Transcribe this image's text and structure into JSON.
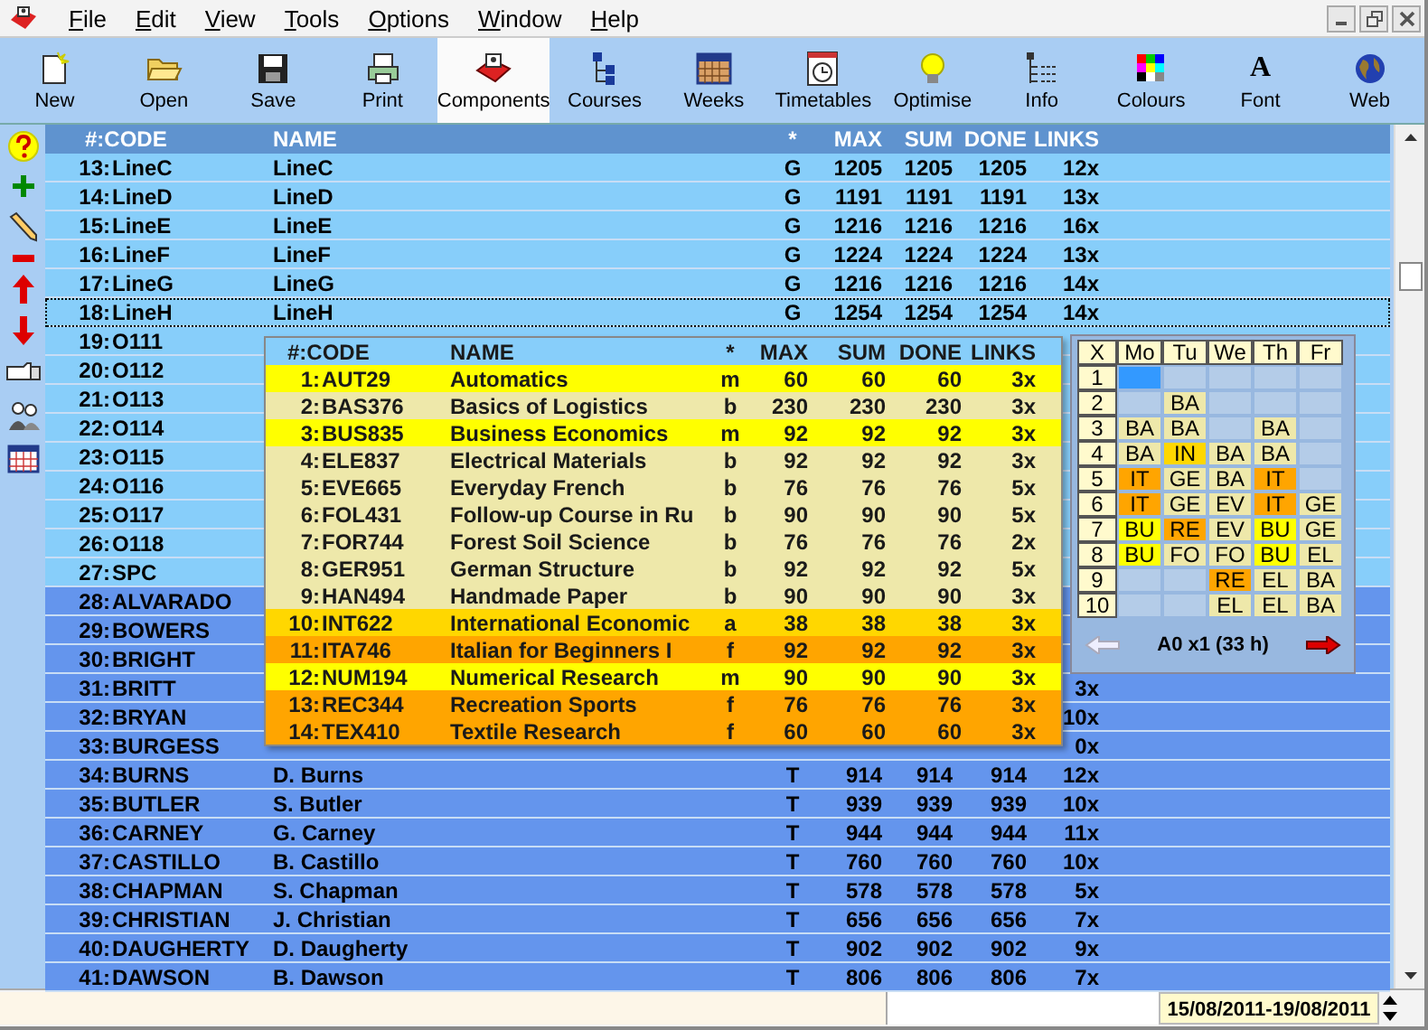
{
  "menu": [
    "File",
    "Edit",
    "View",
    "Tools",
    "Options",
    "Window",
    "Help"
  ],
  "toolbar": [
    {
      "label": "New",
      "selected": false
    },
    {
      "label": "Open",
      "selected": false
    },
    {
      "label": "Save",
      "selected": false
    },
    {
      "label": "Print",
      "selected": false
    },
    {
      "label": "Components",
      "selected": true
    },
    {
      "label": "Courses",
      "selected": false
    },
    {
      "label": "Weeks",
      "selected": false
    },
    {
      "label": "Timetables",
      "selected": false
    },
    {
      "label": "Optimise",
      "selected": false
    },
    {
      "label": "Info",
      "selected": false
    },
    {
      "label": "Colours",
      "selected": false
    },
    {
      "label": "Font",
      "selected": false,
      "glyph": "A"
    },
    {
      "label": "Web",
      "selected": false
    }
  ],
  "table": {
    "columns": [
      "#:CODE",
      "NAME",
      "*",
      "MAX",
      "SUM",
      "DONE",
      "LINKS"
    ],
    "rows": [
      {
        "num": "13:",
        "code": "LineC",
        "name": "LineC",
        "star": "G",
        "max": "1205",
        "sum": "1205",
        "done": "1205",
        "links": "12x",
        "color": "#87cefa",
        "selected": false
      },
      {
        "num": "14:",
        "code": "LineD",
        "name": "LineD",
        "star": "G",
        "max": "1191",
        "sum": "1191",
        "done": "1191",
        "links": "13x",
        "color": "#87cefa",
        "selected": false
      },
      {
        "num": "15:",
        "code": "LineE",
        "name": "LineE",
        "star": "G",
        "max": "1216",
        "sum": "1216",
        "done": "1216",
        "links": "16x",
        "color": "#87cefa",
        "selected": false
      },
      {
        "num": "16:",
        "code": "LineF",
        "name": "LineF",
        "star": "G",
        "max": "1224",
        "sum": "1224",
        "done": "1224",
        "links": "13x",
        "color": "#87cefa",
        "selected": false
      },
      {
        "num": "17:",
        "code": "LineG",
        "name": "LineG",
        "star": "G",
        "max": "1216",
        "sum": "1216",
        "done": "1216",
        "links": "14x",
        "color": "#87cefa",
        "selected": false
      },
      {
        "num": "18:",
        "code": "LineH",
        "name": "LineH",
        "star": "G",
        "max": "1254",
        "sum": "1254",
        "done": "1254",
        "links": "14x",
        "color": "#87cefa",
        "selected": true
      },
      {
        "num": "19:",
        "code": "O111",
        "color": "#87cefa",
        "selected": false
      },
      {
        "num": "20:",
        "code": "O112",
        "color": "#87cefa",
        "selected": false
      },
      {
        "num": "21:",
        "code": "O113",
        "color": "#87cefa",
        "selected": false
      },
      {
        "num": "22:",
        "code": "O114",
        "color": "#87cefa",
        "selected": false
      },
      {
        "num": "23:",
        "code": "O115",
        "color": "#87cefa",
        "selected": false
      },
      {
        "num": "24:",
        "code": "O116",
        "color": "#87cefa",
        "selected": false
      },
      {
        "num": "25:",
        "code": "O117",
        "color": "#87cefa",
        "selected": false
      },
      {
        "num": "26:",
        "code": "O118",
        "color": "#87cefa",
        "selected": false
      },
      {
        "num": "27:",
        "code": "SPC",
        "color": "#87cefa",
        "selected": false
      },
      {
        "num": "28:",
        "code": "ALVARADO",
        "color": "#6495ed",
        "selected": false
      },
      {
        "num": "29:",
        "code": "BOWERS",
        "color": "#6495ed",
        "selected": false
      },
      {
        "num": "30:",
        "code": "BRIGHT",
        "color": "#6495ed",
        "selected": false
      },
      {
        "num": "31:",
        "code": "BRITT",
        "links": "3x",
        "color": "#6495ed",
        "selected": false
      },
      {
        "num": "32:",
        "code": "BRYAN",
        "links": "10x",
        "color": "#6495ed",
        "selected": false
      },
      {
        "num": "33:",
        "code": "BURGESS",
        "links": "0x",
        "color": "#6495ed",
        "selected": false
      },
      {
        "num": "34:",
        "code": "BURNS",
        "name": "D. Burns",
        "star": "T",
        "max": "914",
        "sum": "914",
        "done": "914",
        "links": "12x",
        "color": "#6495ed",
        "selected": false
      },
      {
        "num": "35:",
        "code": "BUTLER",
        "name": "S. Butler",
        "star": "T",
        "max": "939",
        "sum": "939",
        "done": "939",
        "links": "10x",
        "color": "#6495ed",
        "selected": false
      },
      {
        "num": "36:",
        "code": "CARNEY",
        "name": "G. Carney",
        "star": "T",
        "max": "944",
        "sum": "944",
        "done": "944",
        "links": "11x",
        "color": "#6495ed",
        "selected": false
      },
      {
        "num": "37:",
        "code": "CASTILLO",
        "name": "B. Castillo",
        "star": "T",
        "max": "760",
        "sum": "760",
        "done": "760",
        "links": "10x",
        "color": "#6495ed",
        "selected": false
      },
      {
        "num": "38:",
        "code": "CHAPMAN",
        "name": "S. Chapman",
        "star": "T",
        "max": "578",
        "sum": "578",
        "done": "578",
        "links": "5x",
        "color": "#6495ed",
        "selected": false
      },
      {
        "num": "39:",
        "code": "CHRISTIAN",
        "name": "J. Christian",
        "star": "T",
        "max": "656",
        "sum": "656",
        "done": "656",
        "links": "7x",
        "color": "#6495ed",
        "selected": false
      },
      {
        "num": "40:",
        "code": "DAUGHERTY",
        "name": "D. Daugherty",
        "star": "T",
        "max": "902",
        "sum": "902",
        "done": "902",
        "links": "9x",
        "color": "#6495ed",
        "selected": false
      },
      {
        "num": "41:",
        "code": "DAWSON",
        "name": "B. Dawson",
        "star": "T",
        "max": "806",
        "sum": "806",
        "done": "806",
        "links": "7x",
        "color": "#6495ed",
        "selected": false
      }
    ]
  },
  "popup": {
    "columns": [
      "#:CODE",
      "NAME",
      "*",
      "MAX",
      "SUM",
      "DONE",
      "LINKS"
    ],
    "rows": [
      {
        "num": "1:",
        "code": "AUT29",
        "name": "Automatics",
        "type": "m",
        "max": "60",
        "sum": "60",
        "done": "60",
        "links": "3x",
        "color": "#ffff00"
      },
      {
        "num": "2:",
        "code": "BAS376",
        "name": "Basics of Logistics",
        "type": "b",
        "max": "230",
        "sum": "230",
        "done": "230",
        "links": "3x",
        "color": "#eee8aa"
      },
      {
        "num": "3:",
        "code": "BUS835",
        "name": "Business Economics",
        "type": "m",
        "max": "92",
        "sum": "92",
        "done": "92",
        "links": "3x",
        "color": "#ffff00"
      },
      {
        "num": "4:",
        "code": "ELE837",
        "name": "Electrical Materials",
        "type": "b",
        "max": "92",
        "sum": "92",
        "done": "92",
        "links": "3x",
        "color": "#eee8aa"
      },
      {
        "num": "5:",
        "code": "EVE665",
        "name": "Everyday French",
        "type": "b",
        "max": "76",
        "sum": "76",
        "done": "76",
        "links": "5x",
        "color": "#eee8aa"
      },
      {
        "num": "6:",
        "code": "FOL431",
        "name": "Follow-up Course in Ru",
        "type": "b",
        "max": "90",
        "sum": "90",
        "done": "90",
        "links": "5x",
        "color": "#eee8aa"
      },
      {
        "num": "7:",
        "code": "FOR744",
        "name": "Forest Soil Science",
        "type": "b",
        "max": "76",
        "sum": "76",
        "done": "76",
        "links": "2x",
        "color": "#eee8aa"
      },
      {
        "num": "8:",
        "code": "GER951",
        "name": "German Structure",
        "type": "b",
        "max": "92",
        "sum": "92",
        "done": "92",
        "links": "5x",
        "color": "#eee8aa"
      },
      {
        "num": "9:",
        "code": "HAN494",
        "name": "Handmade Paper",
        "type": "b",
        "max": "90",
        "sum": "90",
        "done": "90",
        "links": "3x",
        "color": "#eee8aa"
      },
      {
        "num": "10:",
        "code": "INT622",
        "name": "International Economic",
        "type": "a",
        "max": "38",
        "sum": "38",
        "done": "38",
        "links": "3x",
        "color": "#ffd700"
      },
      {
        "num": "11:",
        "code": "ITA746",
        "name": "Italian for Beginners I",
        "type": "f",
        "max": "92",
        "sum": "92",
        "done": "92",
        "links": "3x",
        "color": "#ffa500"
      },
      {
        "num": "12:",
        "code": "NUM194",
        "name": "Numerical Research",
        "type": "m",
        "max": "90",
        "sum": "90",
        "done": "90",
        "links": "3x",
        "color": "#ffff00"
      },
      {
        "num": "13:",
        "code": "REC344",
        "name": "Recreation Sports",
        "type": "f",
        "max": "76",
        "sum": "76",
        "done": "76",
        "links": "3x",
        "color": "#ffa500"
      },
      {
        "num": "14:",
        "code": "TEX410",
        "name": "Textile Research",
        "type": "f",
        "max": "60",
        "sum": "60",
        "done": "60",
        "links": "3x",
        "color": "#ffa500"
      }
    ]
  },
  "timetable": {
    "corner": "X",
    "days": [
      "Mo",
      "Tu",
      "We",
      "Th",
      "Fr"
    ],
    "periods": [
      {
        "label": "1",
        "cells": [
          {
            "color": "#3399ff"
          },
          {
            "color": "#b4cce8"
          },
          {
            "color": "#b4cce8"
          },
          {
            "color": "#b4cce8"
          },
          {
            "color": "#b4cce8"
          }
        ]
      },
      {
        "label": "2",
        "cells": [
          {
            "color": "#b4cce8"
          },
          {
            "text": "BA",
            "color": "#eee8aa"
          },
          {
            "color": "#b4cce8"
          },
          {
            "color": "#b4cce8"
          },
          {
            "color": "#b4cce8"
          }
        ]
      },
      {
        "label": "3",
        "cells": [
          {
            "text": "BA",
            "color": "#eee8aa"
          },
          {
            "text": "BA",
            "color": "#eee8aa"
          },
          {
            "color": "#b4cce8"
          },
          {
            "text": "BA",
            "color": "#eee8aa"
          },
          {
            "color": "#b4cce8"
          }
        ]
      },
      {
        "label": "4",
        "cells": [
          {
            "text": "BA",
            "color": "#eee8aa"
          },
          {
            "text": "IN",
            "color": "#ffd700"
          },
          {
            "text": "BA",
            "color": "#eee8aa"
          },
          {
            "text": "BA",
            "color": "#eee8aa"
          },
          {
            "color": "#b4cce8"
          }
        ]
      },
      {
        "label": "5",
        "cells": [
          {
            "text": "IT",
            "color": "#ffa500"
          },
          {
            "text": "GE",
            "color": "#eee8aa"
          },
          {
            "text": "BA",
            "color": "#eee8aa"
          },
          {
            "text": "IT",
            "color": "#ffa500"
          },
          {
            "color": "#b4cce8"
          }
        ]
      },
      {
        "label": "6",
        "cells": [
          {
            "text": "IT",
            "color": "#ffa500"
          },
          {
            "text": "GE",
            "color": "#eee8aa"
          },
          {
            "text": "EV",
            "color": "#eee8aa"
          },
          {
            "text": "IT",
            "color": "#ffa500"
          },
          {
            "text": "GE",
            "color": "#eee8aa"
          }
        ]
      },
      {
        "label": "7",
        "cells": [
          {
            "text": "BU",
            "color": "#ffff00"
          },
          {
            "text": "RE",
            "color": "#ffa500"
          },
          {
            "text": "EV",
            "color": "#eee8aa"
          },
          {
            "text": "BU",
            "color": "#ffff00"
          },
          {
            "text": "GE",
            "color": "#eee8aa"
          }
        ]
      },
      {
        "label": "8",
        "cells": [
          {
            "text": "BU",
            "color": "#ffff00"
          },
          {
            "text": "FO",
            "color": "#eee8aa"
          },
          {
            "text": "FO",
            "color": "#eee8aa"
          },
          {
            "text": "BU",
            "color": "#ffff00"
          },
          {
            "text": "EL",
            "color": "#eee8aa"
          }
        ]
      },
      {
        "label": "9",
        "cells": [
          {
            "color": "#b4cce8"
          },
          {
            "color": "#b4cce8"
          },
          {
            "text": "RE",
            "color": "#ffa500"
          },
          {
            "text": "EL",
            "color": "#eee8aa"
          },
          {
            "text": "BA",
            "color": "#eee8aa"
          }
        ]
      },
      {
        "label": "10",
        "cells": [
          {
            "color": "#b4cce8"
          },
          {
            "color": "#b4cce8"
          },
          {
            "text": "EL",
            "color": "#eee8aa"
          },
          {
            "text": "EL",
            "color": "#eee8aa"
          },
          {
            "text": "BA",
            "color": "#eee8aa"
          }
        ]
      }
    ],
    "caption": "A0 x1 (33 h)",
    "prev_disabled": true,
    "next_disabled": false
  },
  "status_bar": {
    "date_range": "15/08/2011-19/08/2011"
  }
}
